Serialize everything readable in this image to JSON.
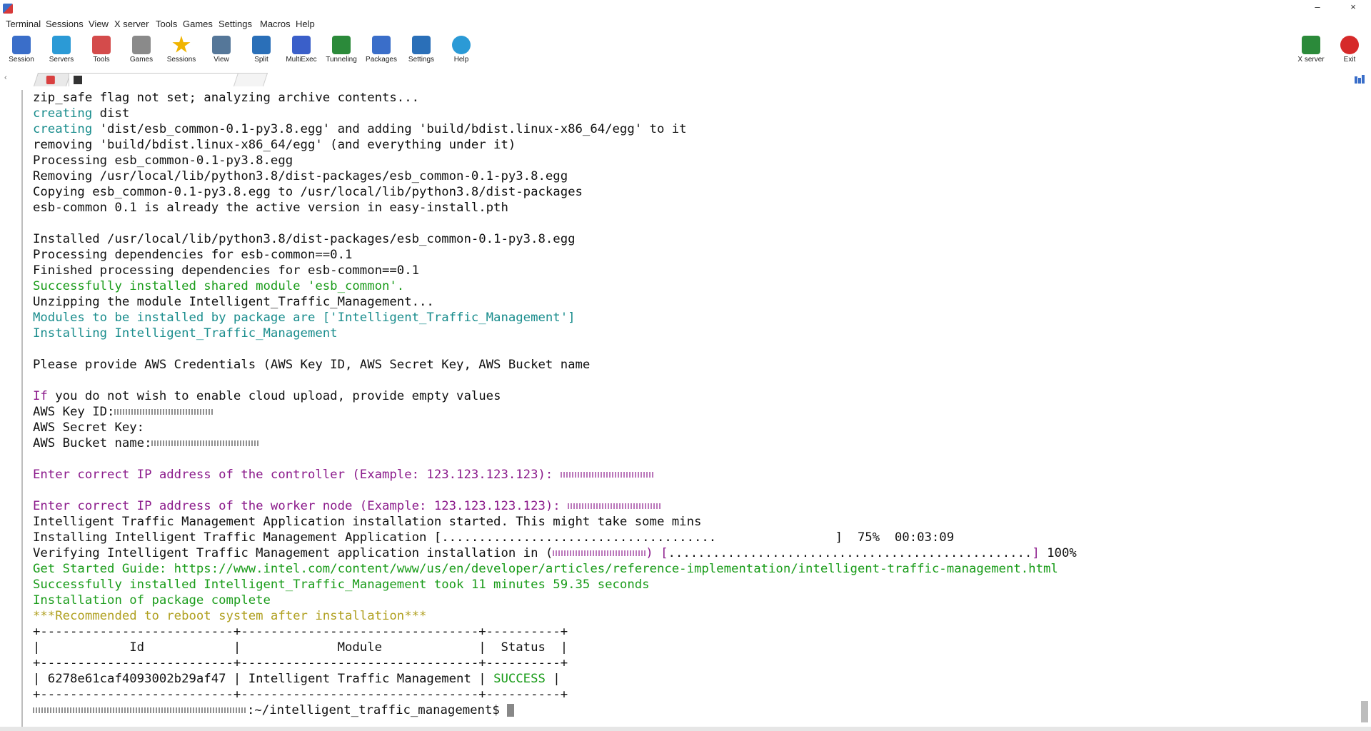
{
  "window": {
    "title": "",
    "minimize_glyph": "–",
    "close_glyph": "×"
  },
  "menu": [
    "Terminal",
    "Sessions",
    "View",
    "X server",
    "Tools",
    "Games",
    "Settings",
    "Macros",
    "Help"
  ],
  "toolbar": [
    {
      "label": "Session",
      "icon": "session-icon",
      "color": "#3a6ec9"
    },
    {
      "label": "Servers",
      "icon": "servers-icon",
      "color": "#2b9ad6"
    },
    {
      "label": "Tools",
      "icon": "tools-icon",
      "color": "#d44b4b"
    },
    {
      "label": "Games",
      "icon": "games-icon",
      "color": "#8a8a8a"
    },
    {
      "label": "Sessions",
      "icon": "star-icon",
      "color": "#f0b400"
    },
    {
      "label": "View",
      "icon": "view-icon",
      "color": "#557799"
    },
    {
      "label": "Split",
      "icon": "split-icon",
      "color": "#2a6fb8"
    },
    {
      "label": "MultiExec",
      "icon": "multiexec-icon",
      "color": "#3a5fc9"
    },
    {
      "label": "Tunneling",
      "icon": "tunneling-icon",
      "color": "#2b8a3a"
    },
    {
      "label": "Packages",
      "icon": "packages-icon",
      "color": "#3a6ec9"
    },
    {
      "label": "Settings",
      "icon": "settings-icon",
      "color": "#2a6fb8"
    },
    {
      "label": "Help",
      "icon": "help-icon",
      "color": "#2b9ad6"
    }
  ],
  "toolbar_right": [
    {
      "label": "X server",
      "icon": "xserver-icon",
      "color": "#2b8a3a"
    },
    {
      "label": "Exit",
      "icon": "exit-icon",
      "color": "#d62a2a"
    }
  ],
  "tabs": {
    "left_glyph": "‹",
    "home": "",
    "session_label": "",
    "close_glyph": "×"
  },
  "terminal": {
    "lines": [
      {
        "text": "zip_safe flag not set; analyzing archive contents...",
        "color": ""
      },
      {
        "segments": [
          {
            "text": "creating",
            "color": "c-cyan"
          },
          {
            "text": " dist",
            "color": ""
          }
        ]
      },
      {
        "segments": [
          {
            "text": "creating",
            "color": "c-cyan"
          },
          {
            "text": " 'dist/esb_common-0.1-py3.8.egg' and adding 'build/bdist.linux-x86_64/egg' to it",
            "color": ""
          }
        ]
      },
      {
        "text": "removing 'build/bdist.linux-x86_64/egg' (and everything under it)",
        "color": ""
      },
      {
        "text": "Processing esb_common-0.1-py3.8.egg",
        "color": ""
      },
      {
        "text": "Removing /usr/local/lib/python3.8/dist-packages/esb_common-0.1-py3.8.egg",
        "color": ""
      },
      {
        "text": "Copying esb_common-0.1-py3.8.egg to /usr/local/lib/python3.8/dist-packages",
        "color": ""
      },
      {
        "text": "esb-common 0.1 is already the active version in easy-install.pth",
        "color": ""
      },
      {
        "text": "",
        "color": ""
      },
      {
        "text": "Installed /usr/local/lib/python3.8/dist-packages/esb_common-0.1-py3.8.egg",
        "color": ""
      },
      {
        "text": "Processing dependencies for esb-common==0.1",
        "color": ""
      },
      {
        "text": "Finished processing dependencies for esb-common==0.1",
        "color": ""
      },
      {
        "text": "Successfully installed shared module 'esb_common'.",
        "color": "c-green"
      },
      {
        "text": "Unzipping the module Intelligent_Traffic_Management...",
        "color": ""
      },
      {
        "text": "Modules to be installed by package are ['Intelligent_Traffic_Management']",
        "color": "c-cyan"
      },
      {
        "text": "Installing Intelligent_Traffic_Management",
        "color": "c-cyan"
      },
      {
        "text": "",
        "color": ""
      },
      {
        "text": "Please provide AWS Credentials (AWS Key ID, AWS Secret Key, AWS Bucket name",
        "color": ""
      },
      {
        "text": "",
        "color": ""
      },
      {
        "segments": [
          {
            "text": "If",
            "color": "c-magenta"
          },
          {
            "text": " you do not wish to enable cloud upload, provide empty values",
            "color": ""
          }
        ]
      },
      {
        "text": "AWS Key ID:",
        "color": "",
        "redact": 140
      },
      {
        "text": "AWS Secret Key:",
        "color": ""
      },
      {
        "text": "AWS Bucket name:",
        "color": "",
        "redact": 150
      },
      {
        "text": "",
        "color": ""
      },
      {
        "text": "Enter correct IP address of the controller (Example: 123.123.123.123): ",
        "color": "c-magenta",
        "redact": 130,
        "redact_class": "purple"
      },
      {
        "text": "",
        "color": ""
      },
      {
        "text": "Enter correct IP address of the worker node (Example: 123.123.123.123): ",
        "color": "c-magenta",
        "redact": 130,
        "redact_class": "purple"
      },
      {
        "text": "Intelligent Traffic Management Application installation started. This might take some mins",
        "color": ""
      },
      {
        "text": "Installing Intelligent Traffic Management Application [.....................................                ]  75%  00:03:09",
        "color": ""
      },
      {
        "segments": [
          {
            "text": "Verifying Intelligent Traffic Management application installation in (",
            "color": ""
          },
          {
            "text": "",
            "color": "",
            "redact": 130,
            "redact_class": "purple"
          },
          {
            "text": ") [",
            "color": "c-magenta"
          },
          {
            "text": ".................................................",
            "color": ""
          },
          {
            "text": "]",
            "color": "c-magenta"
          },
          {
            "text": " 100%",
            "color": ""
          }
        ]
      },
      {
        "text": "Get Started Guide: https://www.intel.com/content/www/us/en/developer/articles/reference-implementation/intelligent-traffic-management.html",
        "color": "c-green"
      },
      {
        "text": "Successfully installed Intelligent_Traffic_Management took 11 minutes 59.35 seconds",
        "color": "c-green"
      },
      {
        "text": "Installation of package complete",
        "color": "c-green"
      },
      {
        "text": "***Recommended to reboot system after installation***",
        "color": "c-yellow"
      },
      {
        "text": "+--------------------------+--------------------------------+----------+",
        "color": ""
      },
      {
        "text": "|            Id            |             Module             |  Status  |",
        "color": ""
      },
      {
        "text": "+--------------------------+--------------------------------+----------+",
        "color": ""
      },
      {
        "segments": [
          {
            "text": "| 6278e61caf4093002b29af47 | Intelligent Traffic Management | ",
            "color": ""
          },
          {
            "text": "SUCCESS",
            "color": "c-green"
          },
          {
            "text": " |",
            "color": ""
          }
        ]
      },
      {
        "text": "+--------------------------+--------------------------------+----------+",
        "color": ""
      },
      {
        "text": ":~/intelligent_traffic_management$ ",
        "color": "",
        "prefix_redact": 300,
        "cursor": true
      }
    ]
  }
}
